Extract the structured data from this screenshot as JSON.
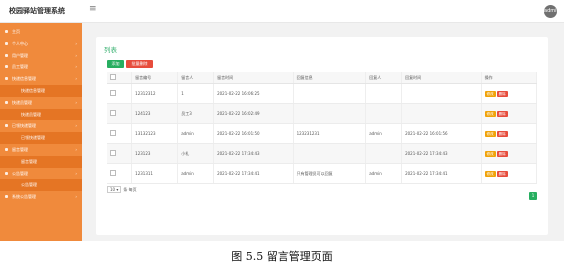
{
  "app": {
    "title": "校园驿站管理系统",
    "menu_icon": "hamburger-icon",
    "avatar_text": "admin"
  },
  "sidebar": {
    "items": [
      {
        "label": "主页",
        "sub": false,
        "caret": ""
      },
      {
        "label": "个人中心",
        "sub": false,
        "caret": "›"
      },
      {
        "label": "用户管理",
        "sub": false,
        "caret": "›"
      },
      {
        "label": "员工管理",
        "sub": false,
        "caret": "›"
      },
      {
        "label": "快递信息管理",
        "sub": false,
        "caret": "›"
      },
      {
        "label": "快递信息管理",
        "sub": true,
        "caret": ""
      },
      {
        "label": "快递员管理",
        "sub": false,
        "caret": "›"
      },
      {
        "label": "快递员管理",
        "sub": true,
        "caret": ""
      },
      {
        "label": "已领快递管理",
        "sub": false,
        "caret": "›"
      },
      {
        "label": "已领快递管理",
        "sub": true,
        "caret": ""
      },
      {
        "label": "留言管理",
        "sub": false,
        "caret": "›"
      },
      {
        "label": "留言管理",
        "sub": true,
        "caret": ""
      },
      {
        "label": "公告管理",
        "sub": false,
        "caret": "›"
      },
      {
        "label": "公告管理",
        "sub": true,
        "caret": ""
      },
      {
        "label": "系统公告管理",
        "sub": false,
        "caret": "›"
      }
    ]
  },
  "main": {
    "title": "列表",
    "add_label": "添加",
    "batch_delete_label": "批量删除",
    "columns": [
      "",
      "留言编号",
      "留言人",
      "留言时间",
      "回复信息",
      "回复人",
      "回复时间",
      "操作"
    ],
    "rows": [
      [
        "",
        "12312312",
        "1",
        "2021-02-22 16:06:25",
        "",
        "",
        "",
        ""
      ],
      [
        "",
        "124123",
        "员工3",
        "2021-02-22 16:02:49",
        "",
        "",
        "",
        ""
      ],
      [
        "",
        "13132123",
        "admin",
        "2021-02-22 16:01:50",
        "123231231",
        "admin",
        "2021-02-22 16:01:56",
        ""
      ],
      [
        "",
        "123123",
        "小礼",
        "2021-02-22 17:34:43",
        "",
        "",
        "2021-02-22 17:34:43",
        ""
      ],
      [
        "",
        "1231311",
        "admin",
        "2021-02-22 17:34:41",
        "只有管理员可以回复",
        "admin",
        "2021-02-22 17:34:41",
        ""
      ]
    ],
    "edit_label": "修改",
    "delete_label": "删除",
    "page_size": "10",
    "page_size_suffix": "条 每页",
    "current_page": "1"
  },
  "caption": "图 5.5  留言管理页面",
  "colors": {
    "sidebar": "#f08a3c",
    "accent_green": "#27ae60",
    "danger": "#e74c3c",
    "warning": "#f0a30a"
  }
}
